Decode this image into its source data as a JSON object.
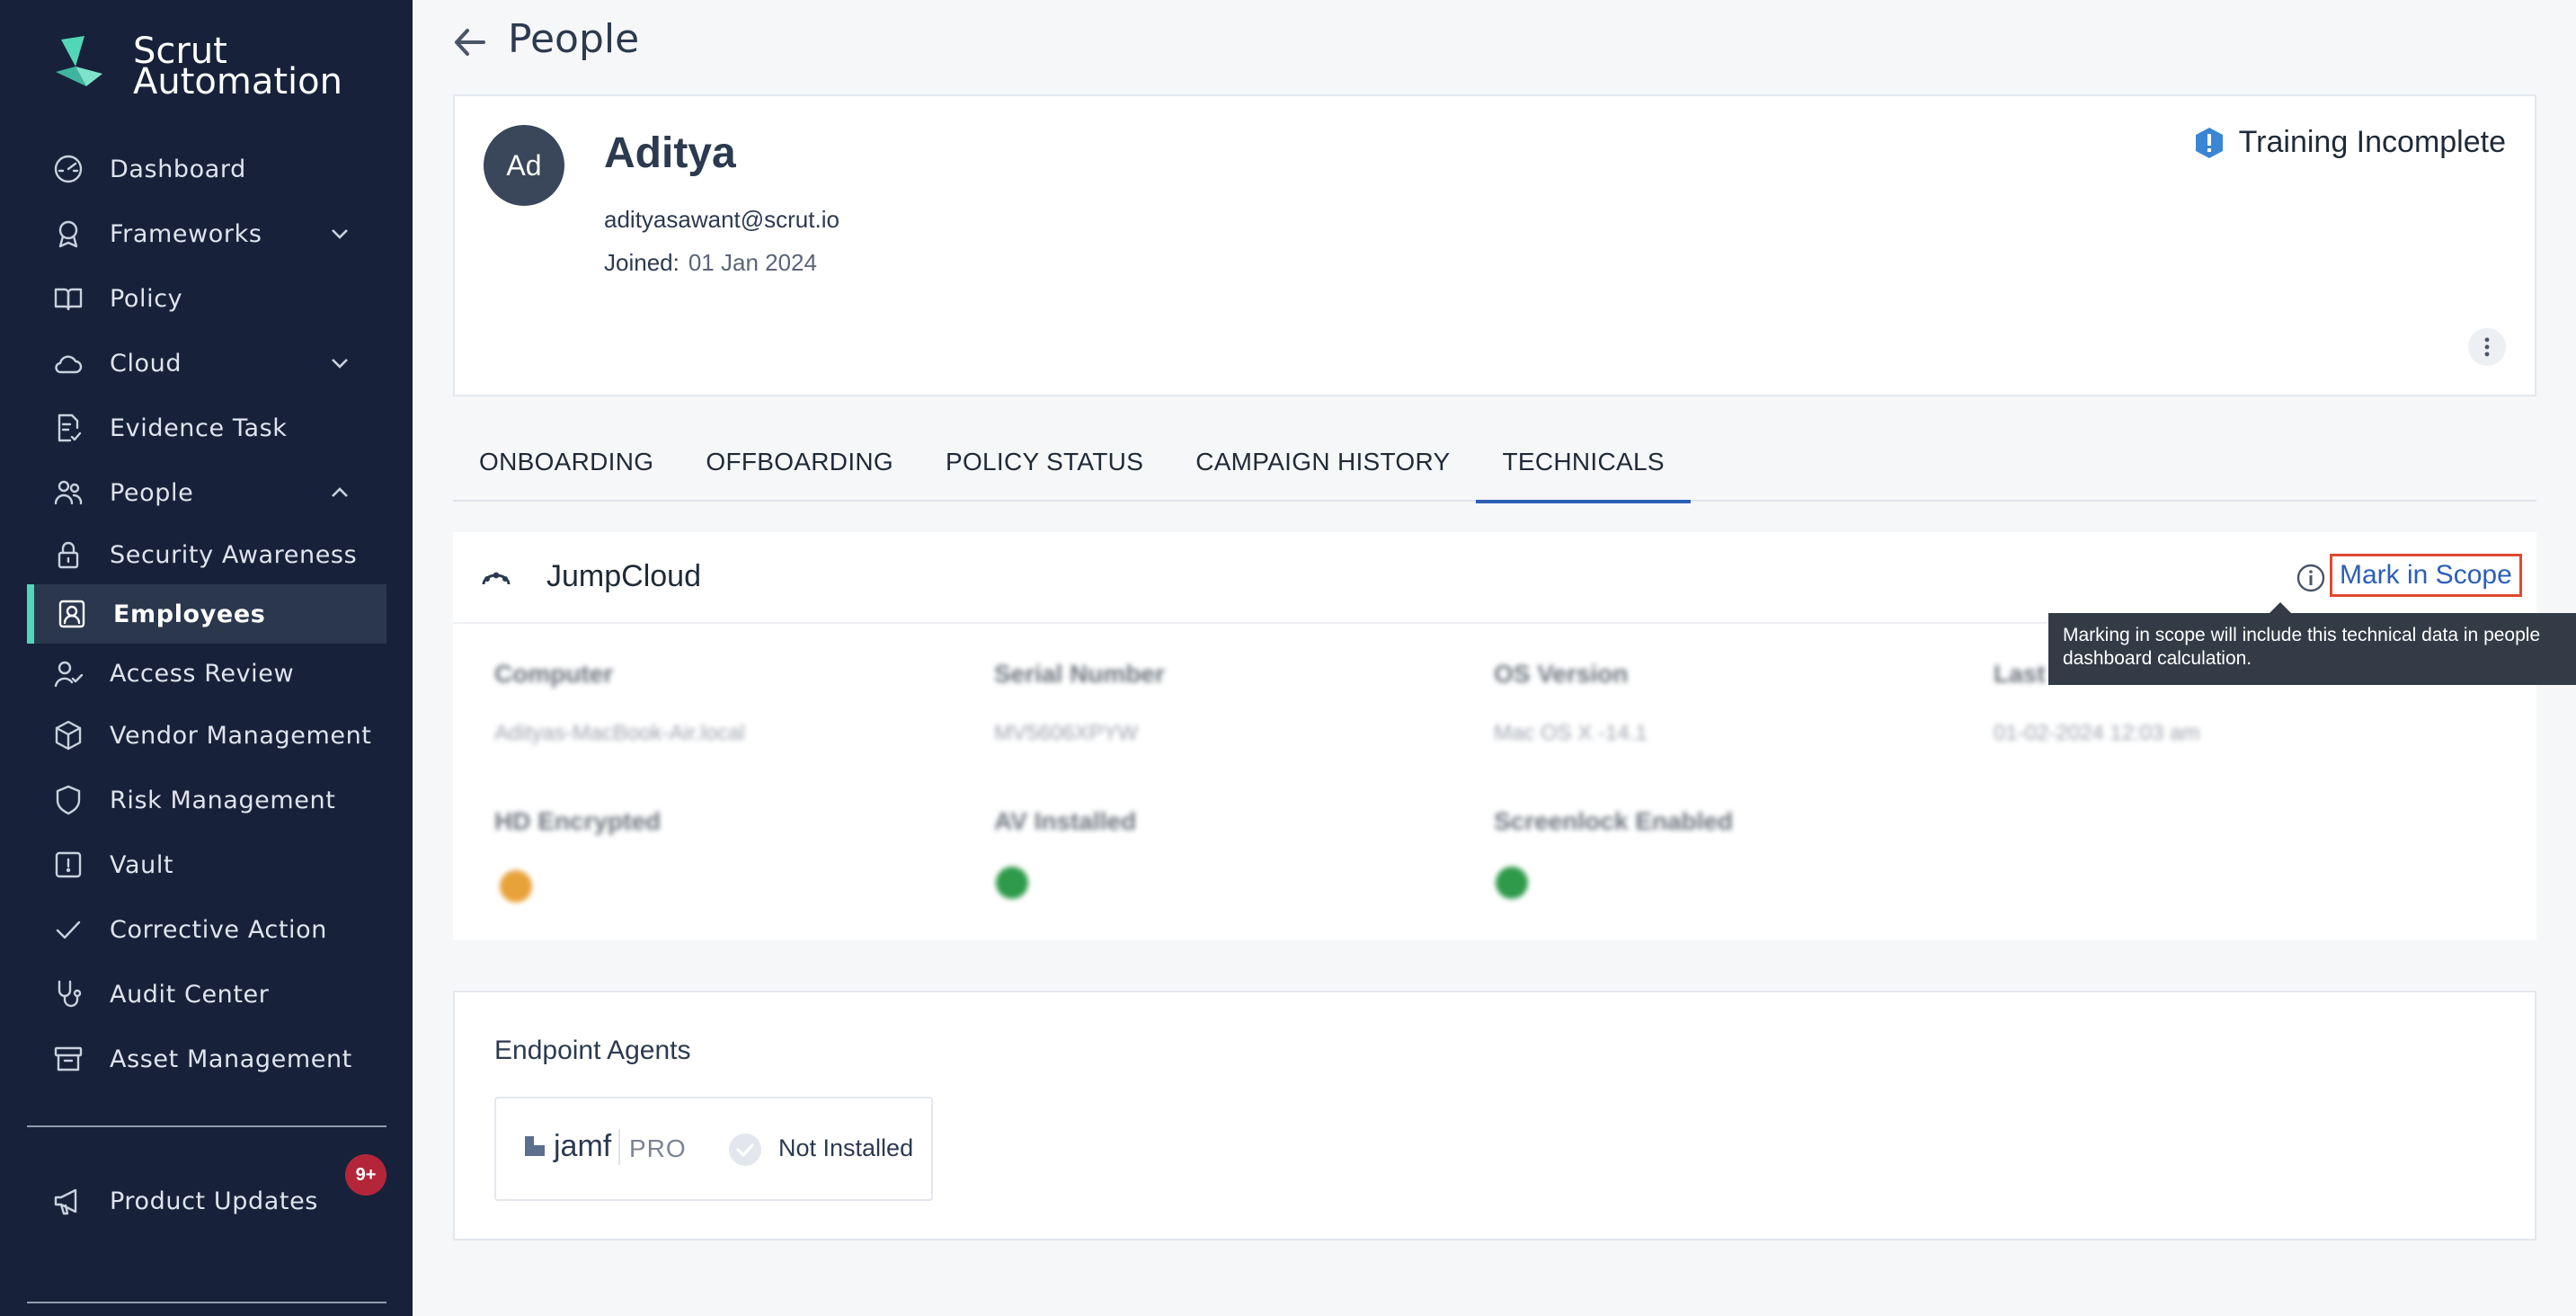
{
  "brand": {
    "line1": "Scrut",
    "line2": "Automation"
  },
  "sidebar": {
    "items": [
      {
        "label": "Dashboard"
      },
      {
        "label": "Frameworks"
      },
      {
        "label": "Policy"
      },
      {
        "label": "Cloud"
      },
      {
        "label": "Evidence Task"
      },
      {
        "label": "People"
      },
      {
        "label": "Security Awareness"
      },
      {
        "label": "Employees"
      },
      {
        "label": "Access Review"
      },
      {
        "label": "Vendor Management"
      },
      {
        "label": "Risk Management"
      },
      {
        "label": "Vault"
      },
      {
        "label": "Corrective Action"
      },
      {
        "label": "Audit Center"
      },
      {
        "label": "Asset Management"
      }
    ],
    "product_updates": {
      "label": "Product Updates",
      "badge": "9+"
    }
  },
  "header": {
    "title": "People"
  },
  "profile": {
    "initials": "Ad",
    "name": "Aditya",
    "email": "adityasawant@scrut.io",
    "joined_label": "Joined:",
    "joined_value": "01 Jan 2024",
    "status": "Training Incomplete"
  },
  "tabs": [
    {
      "label": "ONBOARDING"
    },
    {
      "label": "OFFBOARDING"
    },
    {
      "label": "POLICY STATUS"
    },
    {
      "label": "CAMPAIGN HISTORY"
    },
    {
      "label": "TECHNICALS"
    }
  ],
  "jumpcloud": {
    "title": "JumpCloud",
    "scope_link": "Mark in Scope",
    "tooltip": "Marking in scope will include this technical data in people dashboard calculation.",
    "fields": [
      {
        "label": "Computer",
        "value": "Adityas-MacBook-Air.local"
      },
      {
        "label": "Serial Number",
        "value": "MV5606XPYW"
      },
      {
        "label": "OS Version",
        "value": "Mac OS X -14.1"
      },
      {
        "label": "Last",
        "value": "01-02-2024 12:03 am"
      }
    ],
    "flags": [
      {
        "label": "HD Encrypted"
      },
      {
        "label": "AV Installed"
      },
      {
        "label": "Screenlock Enabled"
      }
    ]
  },
  "endpoint": {
    "title": "Endpoint Agents",
    "agent_name": "jamf",
    "agent_suffix": "PRO",
    "agent_status": "Not Installed"
  },
  "colors": {
    "sidebar_bg": "#17223a",
    "accent": "#2c5fb5",
    "active_bar": "#52d6b8",
    "warn": "#e8a23a",
    "ok": "#2e9a4a"
  }
}
